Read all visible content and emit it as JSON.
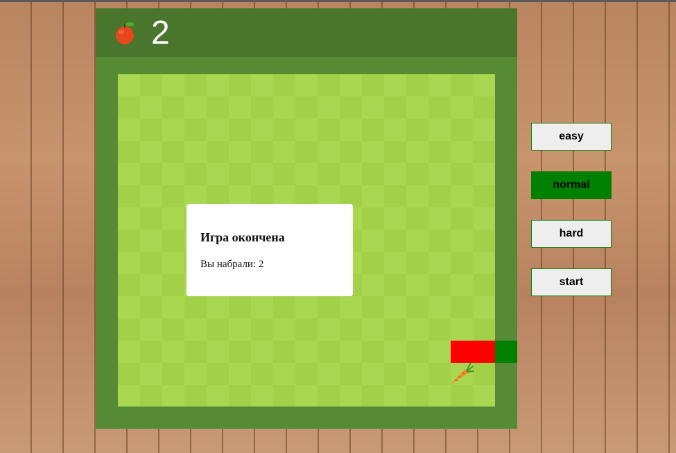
{
  "score": {
    "value": "2",
    "icon": "apple-icon"
  },
  "board": {
    "light_color": "#aad751",
    "dark_color": "#a2d149",
    "frame_color": "#578a34",
    "header_color": "#4a752c",
    "food_icon": "carrot-icon",
    "snake_colors": [
      "#ff0000",
      "#008000"
    ]
  },
  "modal": {
    "title": "Игра окончена",
    "text": "Вы набрали: 2"
  },
  "controls": {
    "easy": "easy",
    "normal": "normal",
    "hard": "hard",
    "start": "start",
    "selected": "normal",
    "selected_color": "#008000"
  }
}
